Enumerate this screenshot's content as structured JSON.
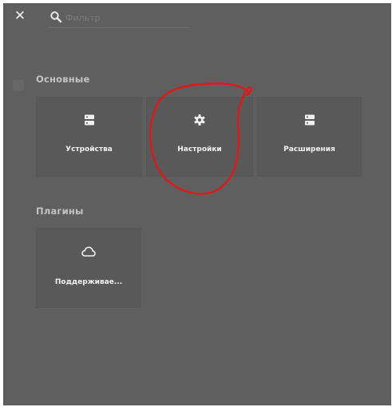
{
  "header": {
    "close_icon": "close-icon",
    "search": {
      "icon": "search-icon",
      "placeholder": "Фильтр"
    }
  },
  "sections": [
    {
      "title": "Основные",
      "tiles": [
        {
          "label": "Устройства",
          "icon": "server-icon"
        },
        {
          "label": "Настройки",
          "icon": "gear-icon"
        },
        {
          "label": "Расширения",
          "icon": "server-icon"
        }
      ]
    },
    {
      "title": "Плагины",
      "tiles": [
        {
          "label": "Поддерживае...",
          "icon": "cloud-icon"
        }
      ]
    }
  ],
  "colors": {
    "background": "#5f5f5f",
    "tile": "#595959",
    "annotation": "#e11818"
  }
}
